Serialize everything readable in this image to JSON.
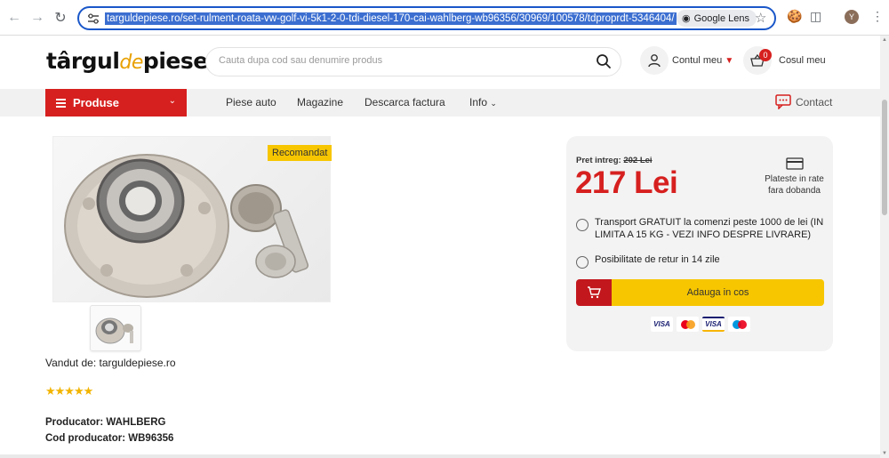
{
  "browser": {
    "url": "targuldepiese.ro/set-rulment-roata-vw-golf-vi-5k1-2-0-tdi-diesel-170-cai-wahlberg-wb96356/30969/100578/tdproprdt-5346404/",
    "lens_label": "Google Lens",
    "profile_initial": "Y"
  },
  "header": {
    "logo_part1": "târgul",
    "logo_part2": "de",
    "logo_part3": "piese",
    "search_placeholder": "Cauta dupa cod sau denumire produs",
    "account_label": "Contul meu",
    "cart_count": "0",
    "cart_label": "Cosul meu"
  },
  "nav": {
    "products_label": "Produse",
    "links": [
      "Piese auto",
      "Magazine",
      "Descarca factura",
      "Info"
    ],
    "contact_label": "Contact"
  },
  "product": {
    "badge": "Recomandat",
    "seller": "Vandut de: targuldepiese.ro",
    "rating_stars": "★★★★★",
    "producer": "Producator: WAHLBERG",
    "producer_code": "Cod producator: WB96356"
  },
  "buybox": {
    "old_price_label": "Pret intreg:",
    "old_price": "202 Lei",
    "price": "217 Lei",
    "installments": "Plateste in rate fara dobanda",
    "shipping": "Transport GRATUIT la comenzi peste 1000 de lei (IN LIMITA A 15 KG - VEZI INFO DESPRE LIVRARE)",
    "returns": "Posibilitate de retur in 14 zile",
    "add_to_cart": "Adauga in cos",
    "payment_logos": [
      "VISA",
      "mastercard",
      "VISA",
      "maestro"
    ]
  },
  "colors": {
    "brand_red": "#d6201f",
    "accent_yellow": "#f7c600"
  }
}
